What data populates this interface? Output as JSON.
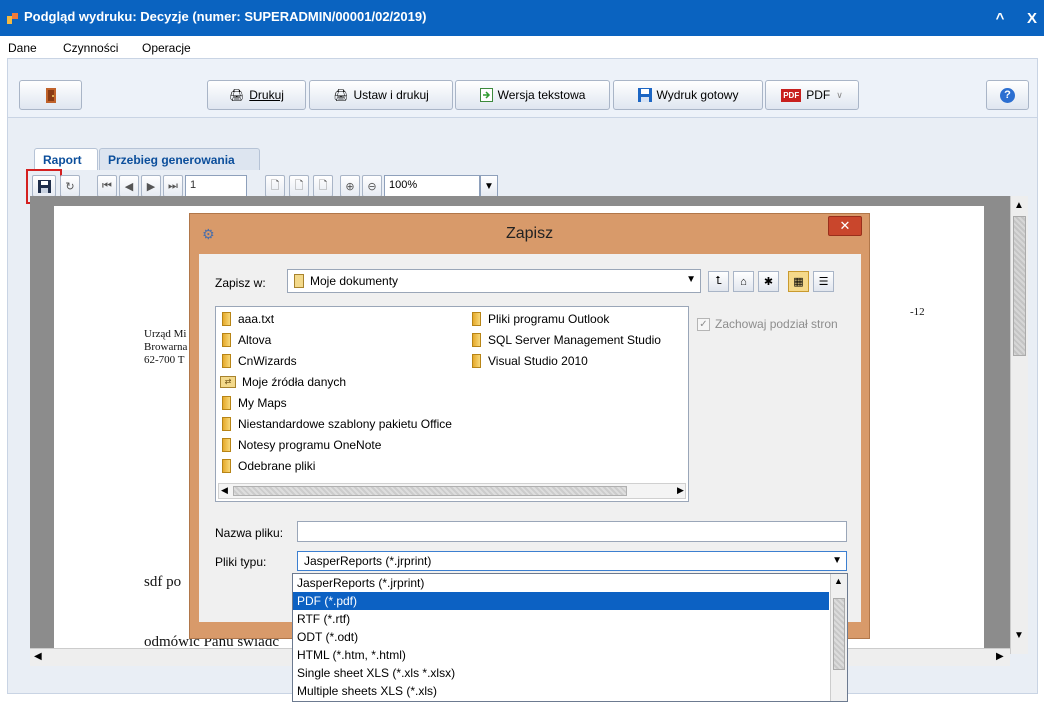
{
  "window": {
    "title": "Podgląd wydruku: Decyzje (numer: SUPERADMIN/00001/02/2019)",
    "minimize_glyph": "^",
    "close_glyph": "X",
    "title_bar_color": "#0a63c0"
  },
  "menu": [
    {
      "label": "Dane",
      "underline": "e"
    },
    {
      "label": "Czynności",
      "underline": "C"
    },
    {
      "label": "Operacje",
      "underline": "O"
    }
  ],
  "toolbar": {
    "exit_icon": "door-exit-icon",
    "print_label": "Drukuj",
    "set_and_print_label": "Ustaw i drukuj",
    "text_version_label": "Wersja tekstowa",
    "ready_print_label": "Wydruk gotowy",
    "pdf_label": "PDF",
    "help_icon": "help-icon"
  },
  "tabs": [
    {
      "label": "Raport",
      "active": true
    },
    {
      "label": "Przebieg generowania",
      "active": false
    }
  ],
  "report_toolbar": {
    "page_number": "1",
    "zoom": "100%"
  },
  "report_page": {
    "line1": "Urząd Mi",
    "line2": "Browarna",
    "line3": "62-700 T",
    "date_fragment": "-12",
    "body1": "sdf po",
    "body2": "odmówić Panu świadc"
  },
  "dialog": {
    "title": "Zapisz",
    "title_color": "#d89a6a",
    "save_in_label": "Zapisz w:",
    "save_in_value": "Moje dokumenty",
    "files_col1": [
      {
        "name": "aaa.txt",
        "type": "folder"
      },
      {
        "name": "Altova",
        "type": "folder"
      },
      {
        "name": "CnWizards",
        "type": "folder"
      },
      {
        "name": "Moje źródła danych",
        "type": "special"
      },
      {
        "name": "My Maps",
        "type": "folder"
      },
      {
        "name": "Niestandardowe szablony pakietu Office",
        "type": "folder"
      },
      {
        "name": "Notesy programu OneNote",
        "type": "folder"
      },
      {
        "name": "Odebrane pliki",
        "type": "folder"
      }
    ],
    "files_col2": [
      {
        "name": "Pliki programu Outlook",
        "type": "folder"
      },
      {
        "name": "SQL Server Management Studio",
        "type": "folder"
      },
      {
        "name": "Visual Studio 2010",
        "type": "folder"
      }
    ],
    "keep_page_split_label": "Zachowaj podział stron",
    "keep_page_split_checked": true,
    "filename_label": "Nazwa pliku:",
    "filename_value": "",
    "filetype_label": "Pliki typu:",
    "filetype_value": "JasperReports (*.jrprint)",
    "filetype_options": [
      {
        "label": "JasperReports (*.jrprint)",
        "selected": false
      },
      {
        "label": "PDF (*.pdf)",
        "selected": true
      },
      {
        "label": "RTF (*.rtf)",
        "selected": false
      },
      {
        "label": "ODT (*.odt)",
        "selected": false
      },
      {
        "label": "HTML (*.htm, *.html)",
        "selected": false
      },
      {
        "label": "Single sheet XLS (*.xls *.xlsx)",
        "selected": false
      },
      {
        "label": "Multiple sheets XLS (*.xls)",
        "selected": false
      }
    ],
    "selection_color": "#0c61c3"
  }
}
